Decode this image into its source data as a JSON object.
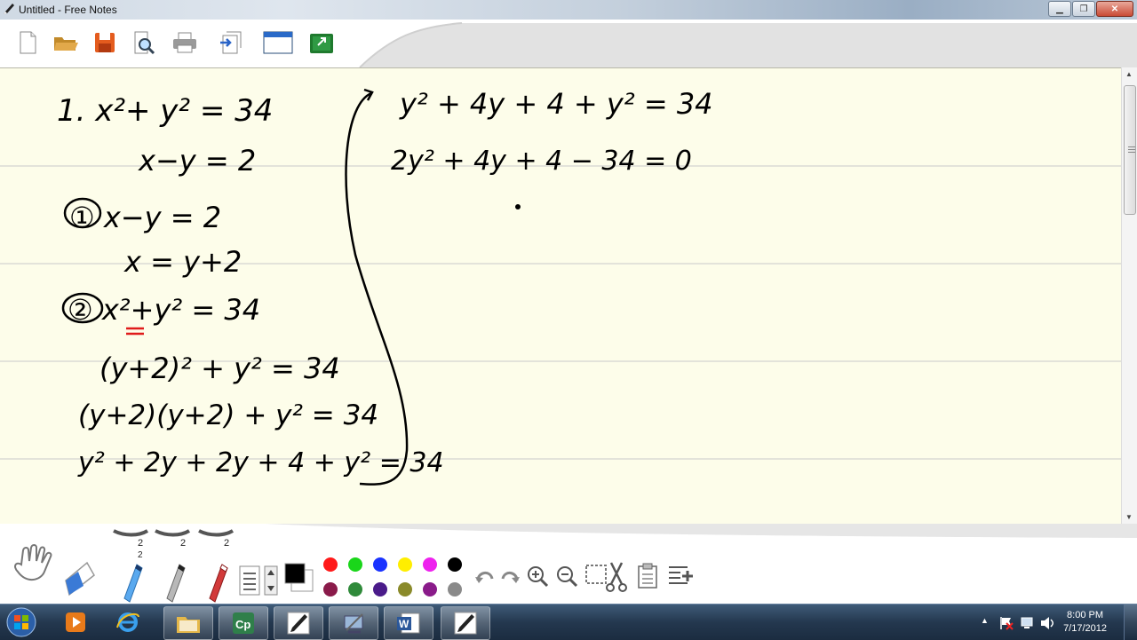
{
  "window": {
    "title": "Untitled - Free Notes"
  },
  "palette": {
    "row1": [
      "#ff1a1a",
      "#1ad61a",
      "#1a33ff",
      "#ffee00",
      "#ee22ee",
      "#000000"
    ],
    "row2": [
      "#8a1b4a",
      "#2f8a3a",
      "#4a1b8a",
      "#8a8a2a",
      "#8a1b8a",
      "#8a8a8a"
    ],
    "selected_color": "#000000"
  },
  "pens": {
    "sizes": [
      "2",
      "2",
      "2"
    ],
    "marker_label": "2"
  },
  "taskbar": {
    "time": "8:00 PM",
    "date": "7/17/2012"
  },
  "notes": {
    "left_column": [
      "1.  x²+ y² = 34",
      "x−y = 2",
      "① x−y = 2",
      "x = y+2",
      "② x²+y² = 34",
      "(y+2)² + y² = 34",
      "(y+2)(y+2) + y² = 34",
      "y² + 2y + 2y + 4 + y² = 34"
    ],
    "right_column": [
      "y² + 4y + 4 + y² = 34",
      "2y² + 4y + 4 − 34 = 0"
    ]
  }
}
